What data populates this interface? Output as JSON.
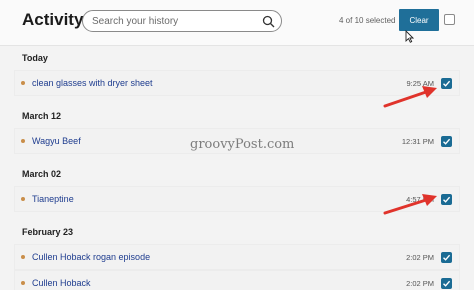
{
  "header": {
    "title": "Activity",
    "search_placeholder": "Search your history",
    "selected_count": "4 of 10 selected",
    "clear_label": "Clear"
  },
  "sections": {
    "today": "Today",
    "march12": "March 12",
    "march02": "March 02",
    "feb23": "February 23"
  },
  "items": [
    {
      "title": "clean glasses with dryer sheet",
      "time": "9:25 AM",
      "checked": true
    },
    {
      "title": "Wagyu Beef",
      "time": "12:31 PM",
      "checked": true
    },
    {
      "title": "Tianeptine",
      "time": "4:57 PM",
      "checked": true
    },
    {
      "title": "Cullen Hoback rogan episode",
      "time": "2:02 PM",
      "checked": true
    },
    {
      "title": "Cullen Hoback",
      "time": "2:02 PM",
      "checked": true
    }
  ],
  "watermark": "groovyPost.com",
  "colors": {
    "accent": "#1f6f99",
    "checkbox": "#1a6b94",
    "link": "#1f3d8f",
    "dot": "#c98e4a",
    "arrow": "#e0332b"
  },
  "icons": [
    "search-icon",
    "checkmark-icon",
    "cursor-icon",
    "arrow-annotation"
  ]
}
